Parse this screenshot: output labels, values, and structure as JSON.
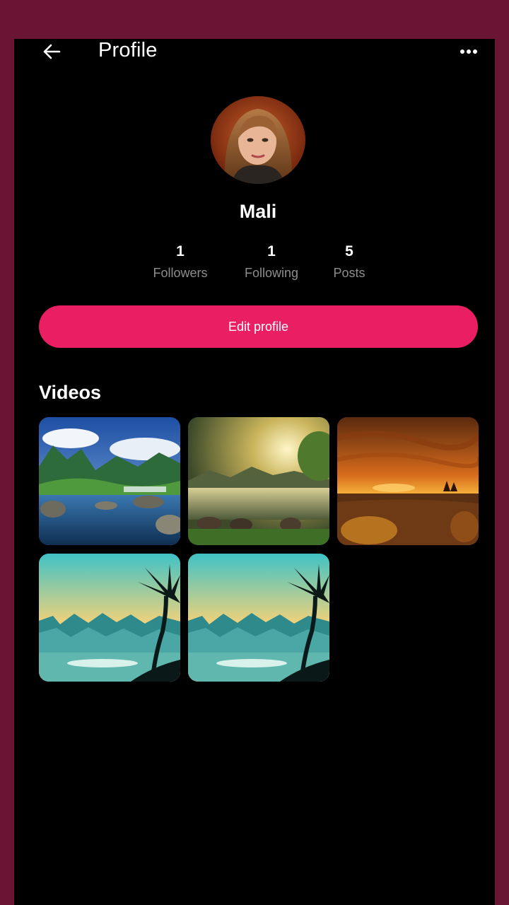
{
  "header": {
    "title": "Profile",
    "back_icon": "arrow-left-icon",
    "more_icon": "more-horizontal-icon"
  },
  "profile": {
    "name": "Mali",
    "avatar": "avatar-photo",
    "stats": [
      {
        "value": "1",
        "label": "Followers"
      },
      {
        "value": "1",
        "label": "Following"
      },
      {
        "value": "5",
        "label": "Posts"
      }
    ],
    "edit_label": "Edit profile"
  },
  "videos": {
    "heading": "Videos",
    "items": [
      {
        "scene": "river-valley"
      },
      {
        "scene": "sunlit-lake"
      },
      {
        "scene": "orange-sunset"
      },
      {
        "scene": "palm-beach"
      },
      {
        "scene": "palm-beach"
      }
    ]
  },
  "colors": {
    "accent": "#e91e63",
    "background": "#000000",
    "frame": "#6b1535",
    "muted_text": "#8d8d8d"
  }
}
